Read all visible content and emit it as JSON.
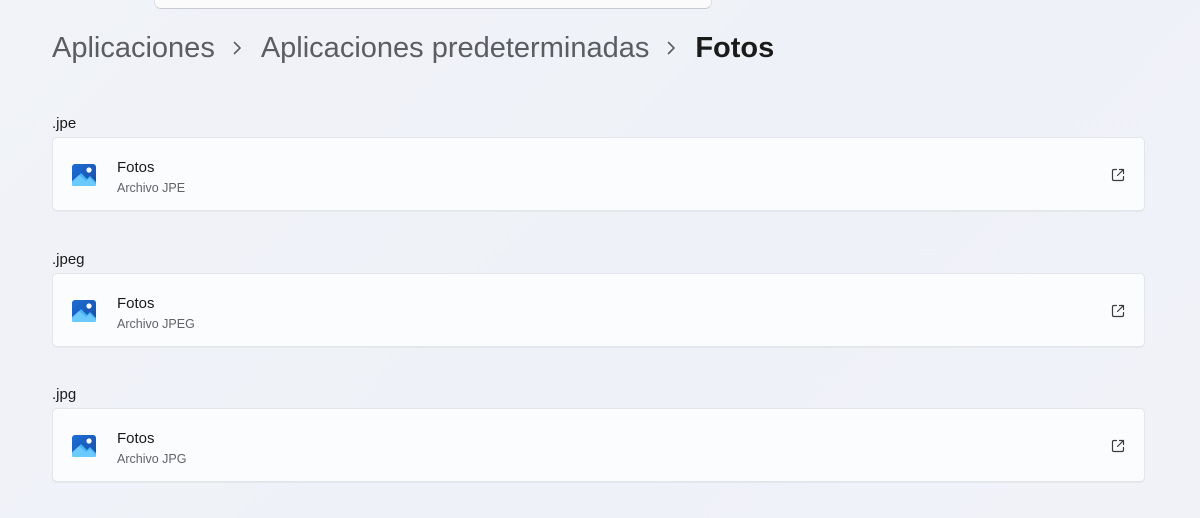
{
  "breadcrumb": {
    "items": [
      "Aplicaciones",
      "Aplicaciones predeterminadas",
      "Fotos"
    ]
  },
  "associations": [
    {
      "extension": ".jpe",
      "app_name": "Fotos",
      "app_desc": "Archivo JPE",
      "icon": "photos-app-icon",
      "action_icon": "open-external-icon"
    },
    {
      "extension": ".jpeg",
      "app_name": "Fotos",
      "app_desc": "Archivo JPEG",
      "icon": "photos-app-icon",
      "action_icon": "open-external-icon"
    },
    {
      "extension": ".jpg",
      "app_name": "Fotos",
      "app_desc": "Archivo JPG",
      "icon": "photos-app-icon",
      "action_icon": "open-external-icon"
    }
  ],
  "colors": {
    "background": "#eff1f7",
    "card": "#fbfcfd",
    "accent": "#0f6cbd"
  }
}
